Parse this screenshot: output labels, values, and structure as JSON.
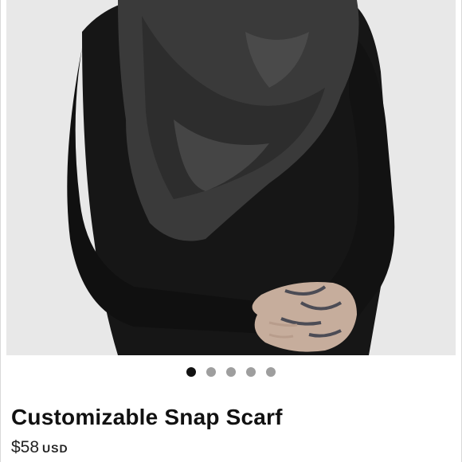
{
  "product": {
    "image_alt_icon": "product-photo",
    "title": "Customizable Snap Scarf",
    "price": "$58",
    "currency": "USD"
  },
  "carousel": {
    "slide_count": 5,
    "active_index": 0,
    "active_color": "#111111",
    "inactive_color": "#9e9e9e"
  }
}
